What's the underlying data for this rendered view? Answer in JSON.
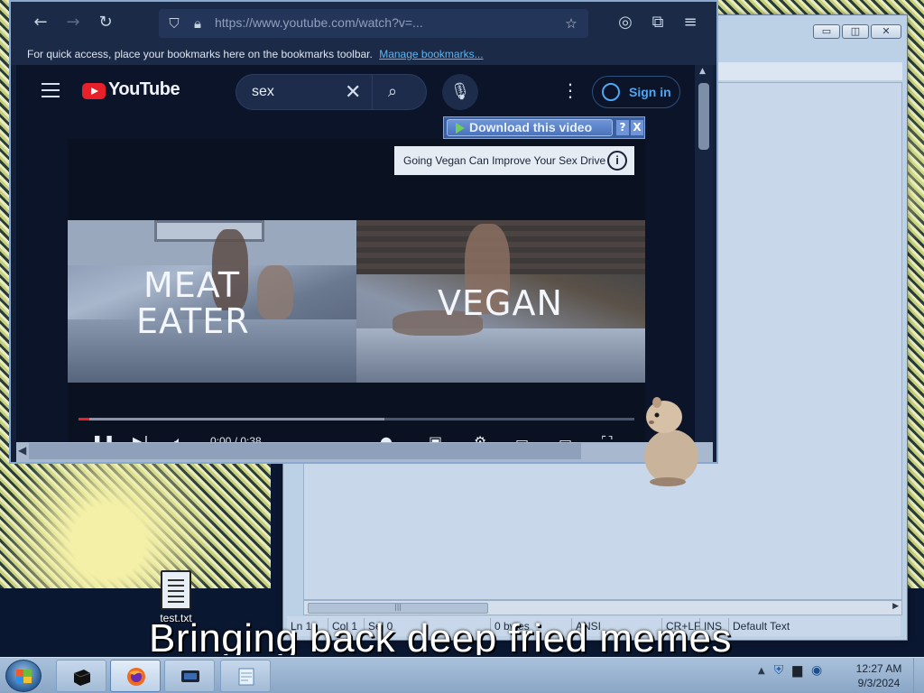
{
  "desktop": {
    "meme_text": "Bringing back deep fried memes",
    "icon_label": "test.txt"
  },
  "notepad": {
    "status": {
      "position": "Ln 1 : 1",
      "col": "Col 1",
      "sel": "Sel 0",
      "size": "0 bytes",
      "encoding": "ANSI",
      "line_ending": "CR+LF",
      "mode": "INS",
      "style": "Default Text"
    }
  },
  "browser": {
    "url": "https://www.youtube.com/watch?v=...",
    "bookmarks_text": "For quick access, place your bookmarks here on the bookmarks toolbar.",
    "bookmarks_link": "Manage bookmarks..."
  },
  "youtube": {
    "logo": "YouTube",
    "search_value": "sex",
    "sign_in": "Sign in",
    "download_label": "Download this video",
    "download_help": "?",
    "download_close": "X",
    "ad_text": "Going Vegan Can Improve Your Sex Drive",
    "ad_info": "i",
    "caption_left_line1": "MEAT",
    "caption_left_line2": "EATER",
    "caption_right": "VEGAN",
    "time": "0:00 / 0:38",
    "progress_played": 0.02,
    "progress_buffered": 0.55
  },
  "taskbar": {
    "time": "12:27 AM",
    "date": "9/3/2024"
  },
  "icons": {
    "back": "back-arrow-icon",
    "forward": "forward-arrow-icon",
    "reload": "reload-icon",
    "shield": "shield-icon",
    "lock": "lock-icon",
    "star": "bookmark-star-icon",
    "menu": "hamburger-menu-icon",
    "search": "search-icon",
    "mic": "microphone-icon"
  },
  "colors": {
    "yt_red": "#e8202a",
    "link_blue": "#5fb4f0",
    "signin_blue": "#4ea7f2"
  }
}
